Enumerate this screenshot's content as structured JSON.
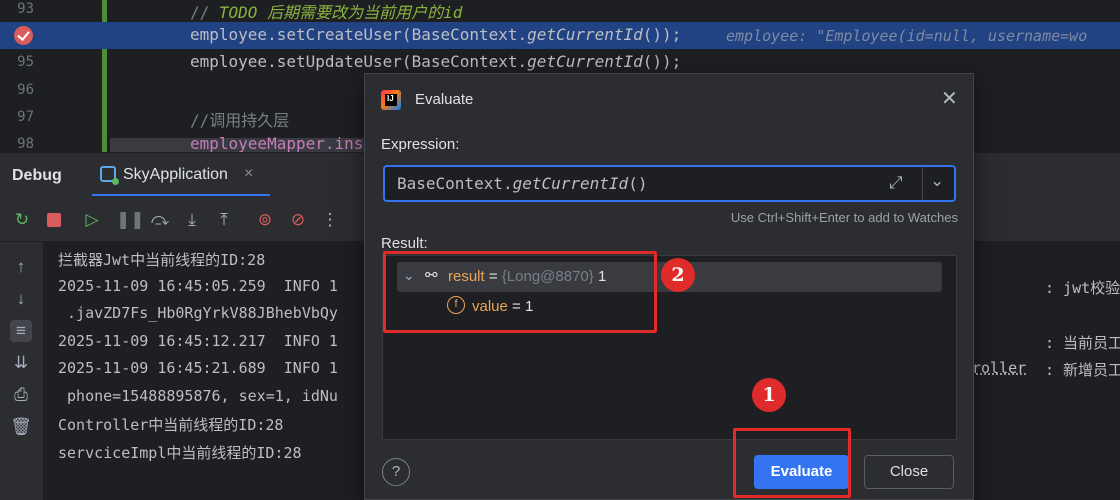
{
  "editor": {
    "lines": [
      {
        "num": "93"
      },
      {
        "num": "",
        "breakpoint": true
      },
      {
        "num": "95"
      },
      {
        "num": "96"
      },
      {
        "num": "97"
      },
      {
        "num": "98"
      }
    ],
    "code": {
      "l93_prefix": "// ",
      "l93_todo": "TODO 后期需要改为当前用户的id",
      "l94_a": "employee.setCreateUser(",
      "l94_b": "BaseContext.",
      "l94_c": "getCurrentId",
      "l94_d": "());",
      "l94_hint": "employee: \"Employee(id=null, username=wo",
      "l95_a": "employee.setUpdateUser(",
      "l95_b": "BaseContext.",
      "l95_c": "getCurrentId",
      "l95_d": "());",
      "l97": "//调用持久层",
      "l98": "employeeMapper.ins"
    }
  },
  "debug": {
    "title": "Debug",
    "tab_label": "SkyApplication",
    "tab_close": "×"
  },
  "console": {
    "lines": [
      "拦截器Jwt中当前线程的ID:28",
      "2025-11-09 16:45:05.259  INFO 1",
      " .javZD7Fs_Hb0RgYrkV88JBhebVbQy",
      "2025-11-09 16:45:12.217  INFO 1",
      "2025-11-09 16:45:21.689  INFO 1",
      " phone=15488895876, sex=1, idNu",
      "Controller中当前线程的ID:28",
      "servciceImpl中当前线程的ID:28"
    ],
    "right_fragments": {
      "r1": ": jwt校验",
      "r3": ": 当前员工",
      "r4_left": "roller",
      "r4_right": ": 新增员工"
    }
  },
  "dialog": {
    "title": "Evaluate",
    "expression_label": "Expression:",
    "expression_a": "BaseContext.",
    "expression_b": "getCurrentId",
    "expression_c": "()",
    "hint": "Use Ctrl+Shift+Enter to add to Watches",
    "result_label": "Result:",
    "result": {
      "name": "result",
      "eq": " = ",
      "type": "{Long@8870}",
      "value": "1",
      "field_name": "value",
      "field_value": "1"
    },
    "help": "?",
    "evaluate_button": "Evaluate",
    "close_button": "Close"
  },
  "annotations": {
    "badge1": "1",
    "badge2": "2",
    "color": "#e02b2b"
  }
}
